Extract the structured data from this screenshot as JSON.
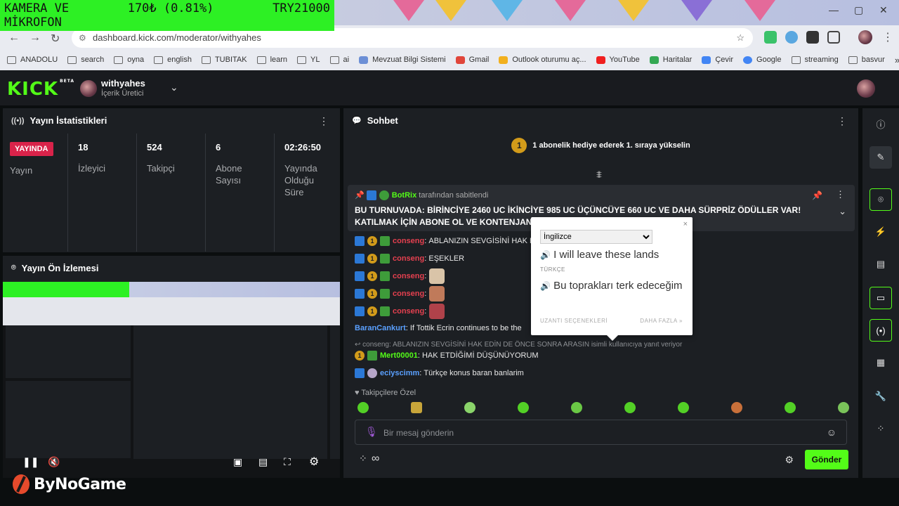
{
  "ticker": {
    "line1_left": "KAMERA VE",
    "line1_mid": "170₺ (0.81%)",
    "line1_right": "TRY21000",
    "line2": "MİKROFON"
  },
  "browser": {
    "url": "dashboard.kick.com/moderator/withyahes",
    "bookmarks": [
      "ANADOLU",
      "search",
      "oyna",
      "english",
      "TUBITAK",
      "learn",
      "YL",
      "ai",
      "Mevzuat Bilgi Sistemi",
      "Gmail",
      "Outlook oturumu aç...",
      "YouTube",
      "Haritalar",
      "Çevir",
      "Google",
      "streaming",
      "basvur"
    ],
    "more": "»"
  },
  "header": {
    "logo": "KICK",
    "logo_sup": "BETA",
    "channel_name": "withyahes",
    "channel_role": "İçerik Üretici"
  },
  "stats": {
    "title": "Yayın İstatistikleri",
    "live_label": "YAYINDA",
    "live_caption": "Yayın",
    "items": [
      {
        "value": "18",
        "label": "İzleyici"
      },
      {
        "value": "524",
        "label": "Takipçi"
      },
      {
        "value": "6",
        "label": "Abone Sayısı"
      },
      {
        "value": "02:26:50",
        "label": "Yayında Olduğu Süre"
      }
    ]
  },
  "preview": {
    "title": "Yayın Ön İzlemesi"
  },
  "chat": {
    "title": "Sohbet",
    "gift_prompt": "1 abonelik hediye ederek 1. sıraya yükselin",
    "gift_rank": "1",
    "pinned": {
      "user": "BotRix",
      "by_suffix": "tarafından sabitlendi",
      "text": "BU TURNUVADA: BİRİNCİYE 2460 UC İKİNCİYE 985 UC ÜÇÜNCÜYE 660 UC VE DAHA SÜRPRİZ ÖDÜLLER VAR! KATILMAK İÇİN ABONE OL VE KONTENJAN D"
    },
    "messages": [
      {
        "user": "conseng",
        "text": "ABLANIZIN SEVGİSİNİ HAK E"
      },
      {
        "user": "conseng",
        "text": "EŞEKLER"
      },
      {
        "user": "conseng",
        "text": ""
      },
      {
        "user": "conseng",
        "text": ""
      },
      {
        "user": "conseng",
        "text": ""
      },
      {
        "user": "BaranCankurt",
        "text": "If Tottik Ecrin continues to be the"
      }
    ],
    "reply_note": "conseng: ABLANIZIN SEVGİSİNİ HAK EDİN DE ÖNCE SONRA ARASIN isimli kullanıcıya yanıt veriyor",
    "reply_messages": [
      {
        "user": "Mert00001",
        "text": "HAK ETDİĞİMİ DÜŞÜNÜYORUM"
      },
      {
        "user": "eciyscimm",
        "text": "Türkçe konus baran banlarim"
      }
    ],
    "emote_section": "Takipçilere Özel",
    "input_placeholder": "Bir mesaj gönderin",
    "send_label": "Gönder",
    "infinity": "∞"
  },
  "translate_popup": {
    "source_lang": "İngilizce",
    "source_text": "I will leave these lands",
    "target_lang": "TÜRKÇE",
    "target_text": "Bu toprakları terk edeceğim",
    "options_link": "UZANTI SEÇENEKLERİ",
    "more_link": "DAHA FAZLA »",
    "close": "×"
  },
  "watermark": {
    "brand": "ByNoGame"
  },
  "colors": {
    "accent": "#53fc18",
    "live": "#d9234a",
    "panel": "#1c1f23",
    "bg": "#0b0e0f"
  }
}
